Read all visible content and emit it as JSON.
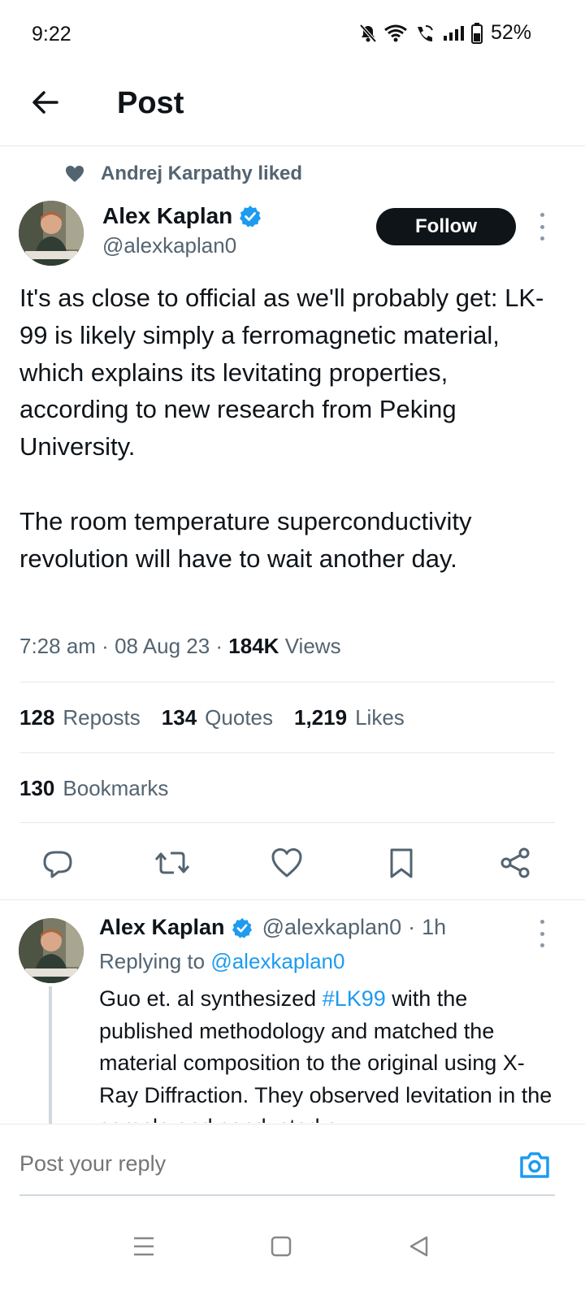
{
  "status_bar": {
    "time": "9:22",
    "battery": "52%",
    "icons": [
      "bell-off-icon",
      "wifi-icon",
      "wifi-call-icon",
      "signal-icon",
      "battery-icon"
    ]
  },
  "header": {
    "title": "Post",
    "back_icon": "arrow-left-icon"
  },
  "social_context": {
    "text": "Andrej Karpathy liked",
    "icon": "heart-icon"
  },
  "post": {
    "author_name": "Alex Kaplan",
    "author_handle": "@alexkaplan0",
    "verified": true,
    "follow_label": "Follow",
    "text": "It's as close to official as we'll probably get: LK-99 is likely simply a ferromagnetic material, which explains its levitating properties, according to new research from Peking University.\n\nThe room temperature superconductivity revolution will have to wait another day.",
    "time": "7:28 am",
    "date": "08 Aug 23",
    "views_count": "184K",
    "views_label": "Views",
    "reposts_count": "128",
    "reposts_label": "Reposts",
    "quotes_count": "134",
    "quotes_label": "Quotes",
    "likes_count": "1,219",
    "likes_label": "Likes",
    "bookmarks_count": "130",
    "bookmarks_label": "Bookmarks"
  },
  "actions": [
    "reply-icon",
    "repost-icon",
    "like-icon",
    "bookmark-icon",
    "share-icon"
  ],
  "reply": {
    "author_name": "Alex Kaplan",
    "author_handle": "@alexkaplan0",
    "time": "1h",
    "replying_prefix": "Replying to",
    "replying_to": "@alexkaplan0",
    "text_before": "Guo et. al synthesized ",
    "hashtag": "#LK99",
    "text_after": " with the published methodology and matched the material composition to the original using X-Ray Diffraction. They observed levitation in the sample and conducted a"
  },
  "composer": {
    "placeholder": "Post your reply"
  },
  "colors": {
    "accent": "#1d9bf0",
    "text": "#0f1419",
    "secondary": "#536471",
    "border": "#e7e9ea"
  }
}
